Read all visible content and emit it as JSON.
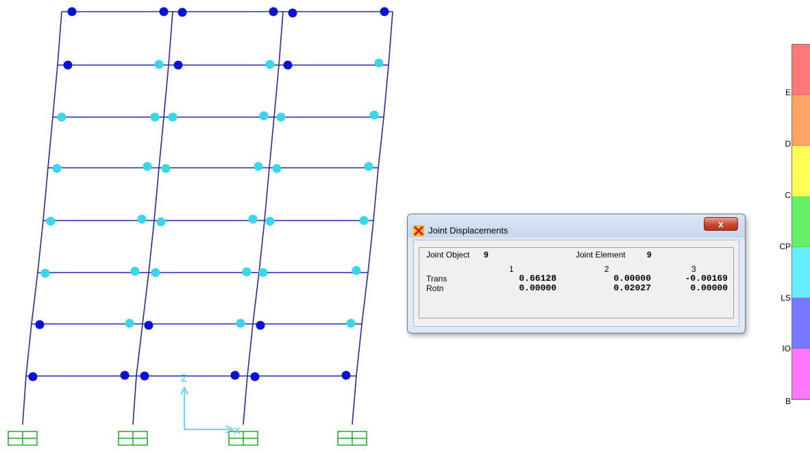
{
  "dialog": {
    "title": "Joint Displacements",
    "close_glyph": "x",
    "joint_object_label": "Joint  Object",
    "joint_object_value": "9",
    "joint_element_label": "Joint Element",
    "joint_element_value": "9",
    "columns": [
      "1",
      "2",
      "3"
    ],
    "rows": [
      {
        "label": "Trans",
        "values": [
          "0.66128",
          "0.00000",
          "-0.00169"
        ]
      },
      {
        "label": "Rotn",
        "values": [
          "0.00000",
          "0.02027",
          "0.00000"
        ]
      }
    ]
  },
  "axes": {
    "z_label": "Z",
    "x_label": "X"
  },
  "legend": {
    "colors": [
      "#ff7777",
      "#ffa366",
      "#ffff55",
      "#66ee66",
      "#66eeff",
      "#7777ff",
      "#ff77ff"
    ],
    "labels": [
      "E",
      "D",
      "C",
      "CP",
      "LS",
      "IO",
      "B"
    ]
  },
  "hinge_colors": {
    "IO": "#0a12d8",
    "LS": "#38d8e8"
  },
  "frame_color": "#2626b8",
  "support_color": "#22aa22"
}
